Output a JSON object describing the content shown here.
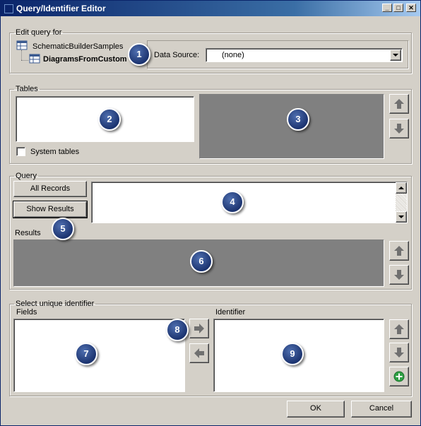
{
  "window": {
    "title": "Query/Identifier Editor",
    "min": "_",
    "max": "□",
    "close": "✕"
  },
  "edit_query": {
    "legend": "Edit query for",
    "tree_parent": "SchematicBuilderSamples",
    "tree_child": "DiagramsFromCustom",
    "data_source_label": "Data Source:",
    "data_source_value": "(none)"
  },
  "tables": {
    "legend": "Tables",
    "system_tables_label": "System tables"
  },
  "query": {
    "legend": "Query",
    "all_records": "All Records",
    "show_results": "Show Results",
    "results_label": "Results"
  },
  "identifier": {
    "legend": "Select unique identifier",
    "fields_label": "Fields",
    "identifier_label": "Identifier"
  },
  "footer": {
    "ok": "OK",
    "cancel": "Cancel"
  },
  "callouts": [
    "1",
    "2",
    "3",
    "4",
    "5",
    "6",
    "7",
    "8",
    "9"
  ],
  "icons": {
    "up": "arrow-up-icon",
    "down": "arrow-down-icon",
    "right": "arrow-right-icon",
    "left": "arrow-left-icon",
    "add": "add-plus-icon"
  },
  "colors": {
    "titlebar": "#0a246a",
    "face": "#d4d0c8",
    "callout": "#1c3470",
    "add_green": "#2ea043"
  }
}
